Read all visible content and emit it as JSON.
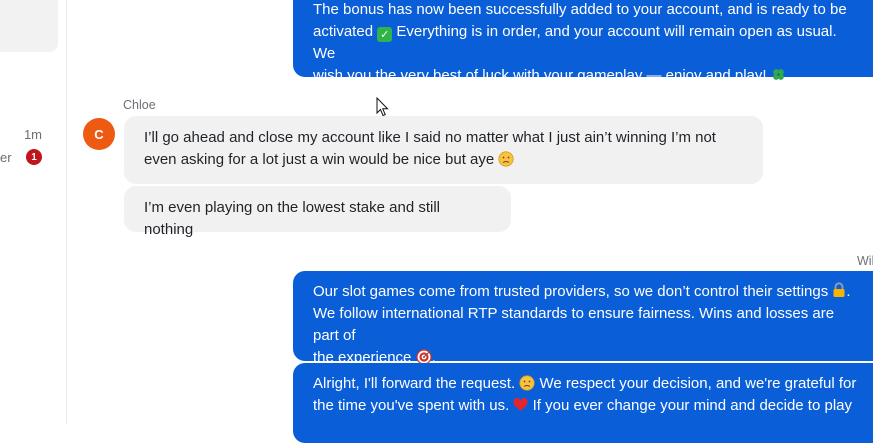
{
  "sidebar": {
    "time": "1m",
    "snippet": "er",
    "badge": "1"
  },
  "messages": {
    "m1": {
      "line1": "The bonus has now been successfully added to your account, and is ready to be",
      "line2a": "activated",
      "line2b": "Everything is in order, and your account will remain open as usual. We",
      "line3": "wish you the very best of luck with your gameplay — enjoy and play!"
    },
    "chloe": {
      "name": "Chloe",
      "avatar_initial": "C",
      "msg1_line1": "I’ll go ahead and close my account like I said no matter what I just ain’t winning I’m not",
      "msg1_line2": "even asking for a lot just a win would be nice but aye",
      "msg2": "I’m even playing on the lowest stake and still nothing"
    },
    "agent_name": "Wil",
    "m3": {
      "line1": "Our slot games come from trusted providers, so we don’t control their settings",
      "line2": "We follow international RTP standards to ensure fairness. Wins and losses are part of",
      "line3": "the experience"
    },
    "m4": {
      "line1a": "Alright, I'll forward the request.",
      "line1b": "We respect your decision, and we're grateful for",
      "line2a": "the time you've spent with us.",
      "line2b": "If you ever change your mind and decide to play"
    }
  },
  "icons": {
    "check": "check-mark-icon",
    "clover": "four-leaf-clover-icon",
    "sad": "sad-face-icon",
    "lock": "lock-icon",
    "target": "target-icon",
    "heart": "heart-icon"
  },
  "colors": {
    "outgoing_bubble": "#0a5fd8",
    "incoming_bubble": "#f1f1f2",
    "avatar": "#ef5a12",
    "badge": "#c0161b"
  }
}
